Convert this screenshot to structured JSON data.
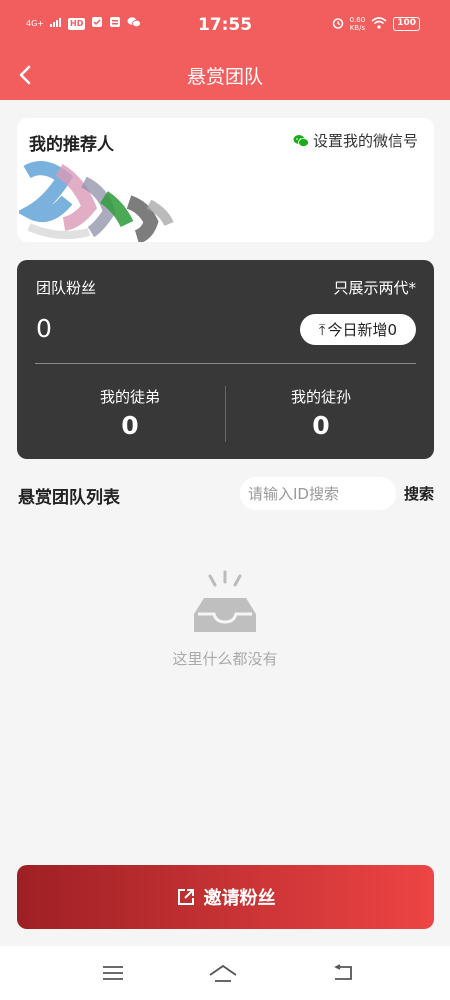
{
  "status_bar": {
    "network": "4G+",
    "hd": "HD",
    "time": "17:55",
    "speed_value": "0.60",
    "speed_unit": "KB/s",
    "battery": "100"
  },
  "nav": {
    "title": "悬赏团队"
  },
  "referrer_card": {
    "title": "我的推荐人",
    "wechat_link": "设置我的微信号"
  },
  "team_card": {
    "label": "团队粉丝",
    "note": "只展示两代*",
    "count": "0",
    "today_arrow": "⤒",
    "today_label": "今日新增0",
    "disciples_label": "我的徒弟",
    "disciples_value": "0",
    "grand_disciples_label": "我的徒孙",
    "grand_disciples_value": "0"
  },
  "list": {
    "title": "悬赏团队列表",
    "search_placeholder": "请输入ID搜索",
    "search_button": "搜索"
  },
  "empty_state": {
    "text": "这里什么都没有"
  },
  "invite_button": {
    "label": "邀请粉丝"
  },
  "colors": {
    "brand": "#f25e5e",
    "card_dark": "#383838",
    "invite_start": "#9e2024",
    "invite_end": "#ee4444",
    "wechat_green": "#1aad19"
  }
}
